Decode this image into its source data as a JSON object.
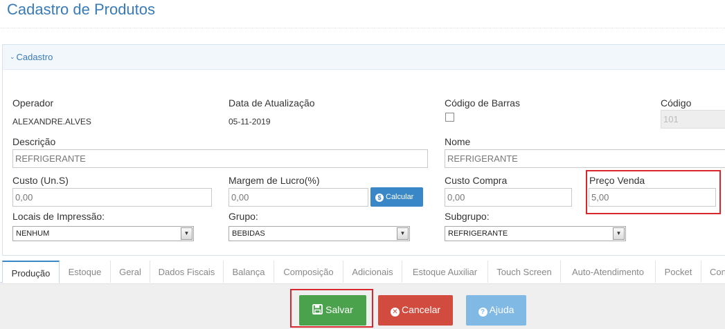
{
  "page": {
    "title": "Cadastro de Produtos"
  },
  "panel": {
    "title": "Cadastro"
  },
  "fields": {
    "operador": {
      "label": "Operador",
      "value": "ALEXANDRE.ALVES"
    },
    "data_atualizacao": {
      "label": "Data de Atualização",
      "value": "05-11-2019"
    },
    "codigo_barras": {
      "label": "Código de Barras",
      "checked": false
    },
    "codigo": {
      "label": "Código",
      "value": "101"
    },
    "descricao": {
      "label": "Descrição",
      "value": "REFRIGERANTE"
    },
    "nome": {
      "label": "Nome",
      "value": "REFRIGERANTE"
    },
    "custo": {
      "label": "Custo (Un.S)",
      "value": "0,00"
    },
    "margem": {
      "label": "Margem de Lucro(%)",
      "value": "0,00"
    },
    "custo_compra": {
      "label": "Custo Compra",
      "value": "0,00"
    },
    "preco_venda": {
      "label": "Preço Venda",
      "value": "5,00"
    },
    "locais_impressao": {
      "label": "Locais de Impressão:",
      "selected": "NENHUM"
    },
    "grupo": {
      "label": "Grupo:",
      "selected": "BEBIDAS"
    },
    "subgrupo": {
      "label": "Subgrupo:",
      "selected": "REFRIGERANTE"
    }
  },
  "buttons": {
    "calcular": {
      "label": "Calcular",
      "icon": "dollar-circle-icon"
    },
    "salvar": {
      "label": "Salvar",
      "icon": "floppy-disk-icon",
      "color": "#4aa24d"
    },
    "cancelar": {
      "label": "Cancelar",
      "icon": "close-circle-icon",
      "color": "#d14b3e"
    },
    "ajuda": {
      "label": "Ajuda",
      "icon": "question-circle-icon",
      "color": "#7fb9e4"
    }
  },
  "tabs": [
    "Produção",
    "Estoque",
    "Geral",
    "Dados Fiscais",
    "Balança",
    "Composição",
    "Adicionais",
    "Estoque Auxiliar",
    "Touch Screen",
    "Auto-Atendimento",
    "Pocket",
    "Con"
  ],
  "active_tab": "Produção",
  "colors": {
    "accent": "#3a7ab7",
    "highlight": "#d9262c"
  }
}
